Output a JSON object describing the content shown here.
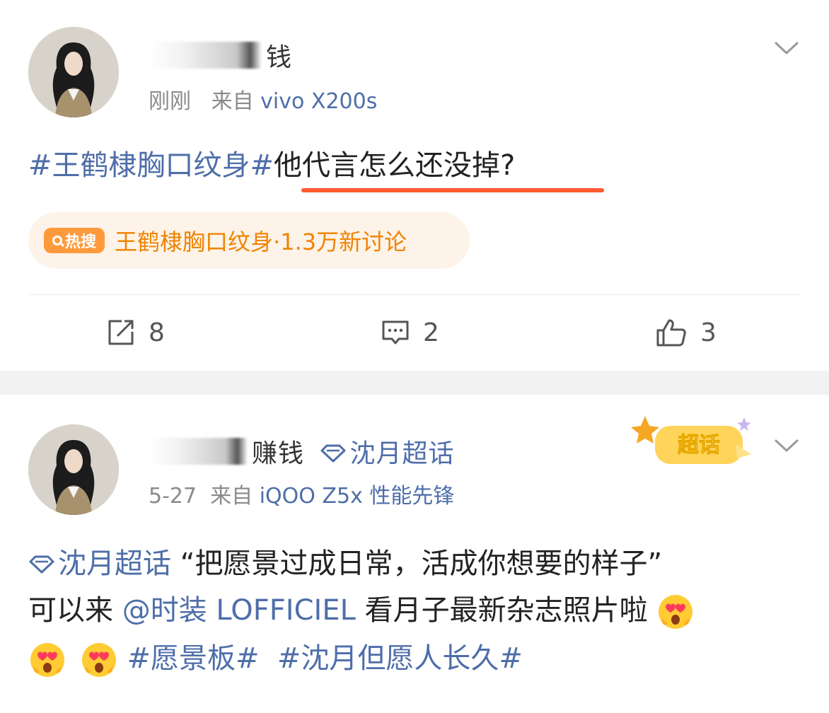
{
  "post1": {
    "username_visible": "钱",
    "time": "刚刚",
    "from_label": "来自",
    "device": "vivo X200s",
    "body": {
      "topic": "#王鹤棣胸口纹身#",
      "text": "他代言怎么还没掉?"
    },
    "hot_search": {
      "badge": "热搜",
      "topic": "王鹤棣胸口纹身",
      "count": "·1.3万新讨论"
    },
    "actions": {
      "repost_count": "8",
      "comment_count": "2",
      "like_count": "3"
    }
  },
  "post2": {
    "username_visible": "赚钱",
    "super_topic": "沈月超话",
    "time": "5-27",
    "from_label": "来自",
    "device": "iQOO Z5x 性能先锋",
    "badge_label": "超话",
    "body": {
      "line1_topic": "沈月超话",
      "line1_quote": "“把愿景过成日常，活成你想要的样子”",
      "line2_prefix": "可以来",
      "line2_mention": "@时装 LOFFICIEL",
      "line2_suffix": "看月子最新杂志照片啦",
      "line3_topic1": "#愿景板#",
      "line3_topic2": "#沈月但愿人长久#"
    }
  },
  "colors": {
    "link": "#4e6ea9",
    "hot_orange": "#f08300",
    "underline_red": "#ff5a30",
    "meta_gray": "#8a8a8a"
  },
  "icons": [
    "repost-icon",
    "comment-icon",
    "like-icon",
    "chevron-down-icon",
    "super-topic-diamond-icon",
    "heart-eyes-emoji"
  ]
}
